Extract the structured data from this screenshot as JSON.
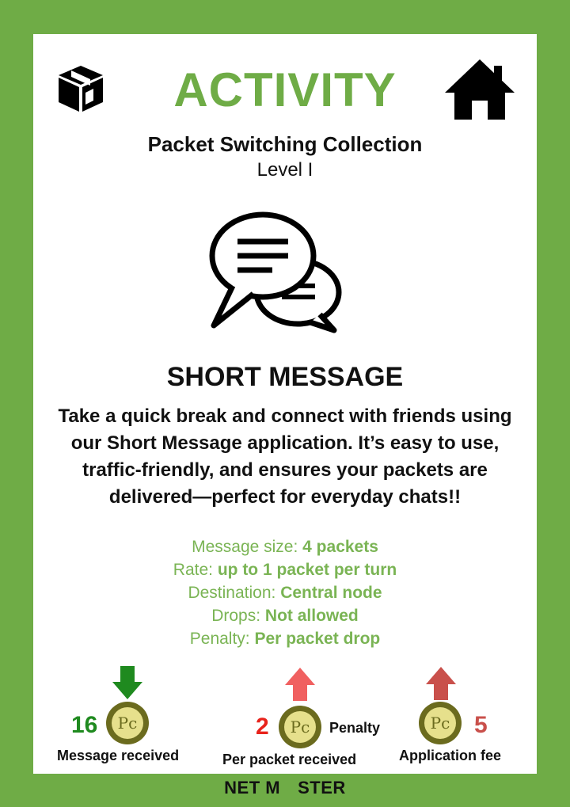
{
  "card": {
    "title": "ACTIVITY",
    "collection": "Packet Switching Collection",
    "level": "Level I",
    "activity_name": "SHORT MESSAGE",
    "description": "Take a quick break and connect with friends using our Short Message application. It’s easy to use, traffic-friendly, and ensures your packets are delivered—perfect for everyday chats!!",
    "details": [
      {
        "label": "Message size:",
        "value": "4 packets"
      },
      {
        "label": "Rate:",
        "value": "up to 1 packet per turn"
      },
      {
        "label": "Destination:",
        "value": "Central node"
      },
      {
        "label": "Drops:",
        "value": "Not allowed"
      },
      {
        "label": "Penalty:",
        "value": "Per packet drop"
      }
    ],
    "rewards": [
      {
        "amount": "16",
        "label": "Message received",
        "direction": "down",
        "color": "#1f8a1f"
      },
      {
        "amount": "2",
        "label": "Per packet received",
        "extra": "Penalty",
        "direction": "up",
        "color": "#e8231c"
      },
      {
        "amount": "5",
        "label": "Application fee",
        "direction": "up",
        "color": "#c9504b"
      }
    ],
    "icons": [
      "package-icon",
      "home-icon",
      "chat-bubbles-icon",
      "coin-icon"
    ]
  },
  "footer": {
    "brand_before": "NET M",
    "brand_after": "STER"
  },
  "colors": {
    "frame": "#6fac46",
    "accent": "#6fac46",
    "details": "#7ab454",
    "coin": "#6b6b1e",
    "arrow_down": "#1f8a1f",
    "arrow_up_light": "#f06060",
    "arrow_up_dark": "#c9504b"
  }
}
